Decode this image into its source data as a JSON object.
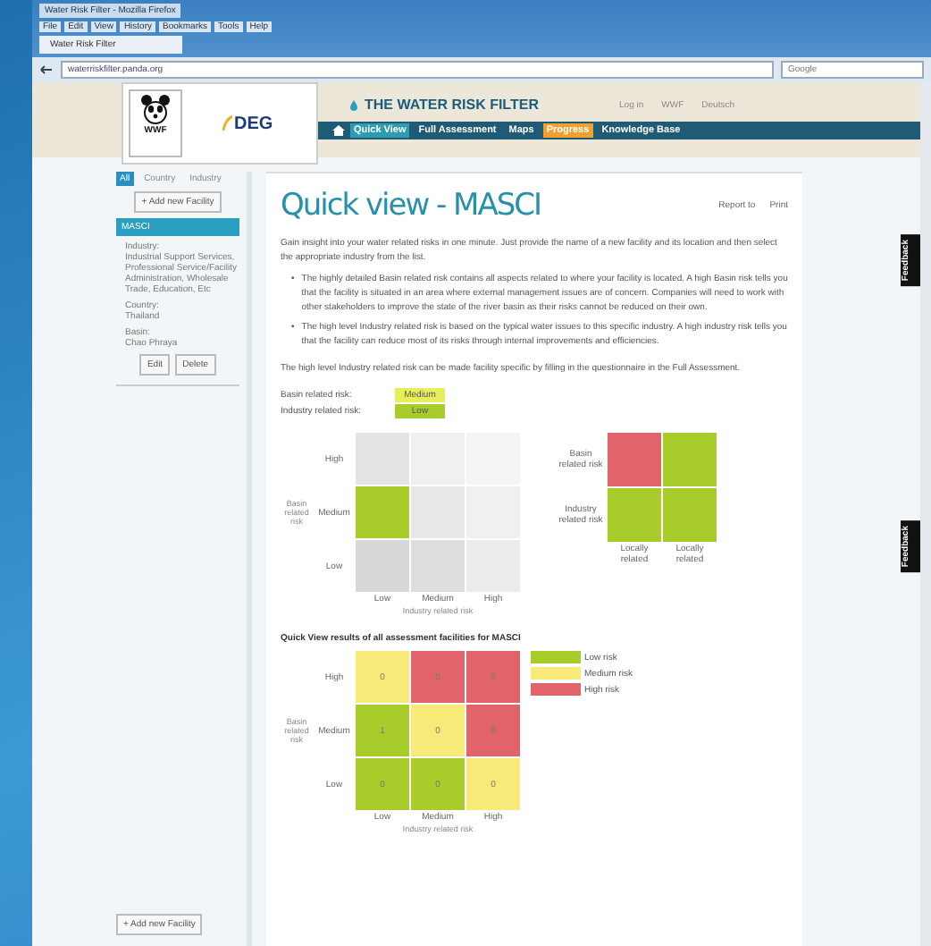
{
  "browser": {
    "title": "Water Risk Filter - Mozilla Firefox",
    "menu": [
      "File",
      "Edit",
      "View",
      "History",
      "Bookmarks",
      "Tools",
      "Help"
    ],
    "tab": "Water Risk Filter",
    "address": "waterriskfilter.panda.org",
    "search_placeholder": "Google"
  },
  "header": {
    "logo_text": "WWF",
    "partner": "DEG",
    "site_title": "THE WATER RISK FILTER",
    "top_links": [
      "Log in",
      "WWF",
      "Deutsch"
    ]
  },
  "nav": [
    {
      "label": "Quick View",
      "selected": true,
      "highlighted": false
    },
    {
      "label": "Full Assessment",
      "selected": false,
      "highlighted": false
    },
    {
      "label": "Maps",
      "selected": false,
      "highlighted": false
    },
    {
      "label": "Progress",
      "selected": false,
      "highlighted": true
    },
    {
      "label": "Knowledge Base",
      "selected": false,
      "highlighted": false
    }
  ],
  "sidebar": {
    "filters": [
      {
        "label": "All",
        "selected": true
      },
      {
        "label": "Country",
        "selected": false
      },
      {
        "label": "Industry",
        "selected": false
      }
    ],
    "add_button": "+ Add new Facility",
    "facility": {
      "name": "MASCI",
      "selected": true,
      "details": [
        {
          "label": "Industry:",
          "value": "Industrial Support Services, Professional Service/Facility Administration, Wholesale Trade, Education, Etc"
        },
        {
          "label": "Country:",
          "value": "Thailand"
        },
        {
          "label": "Basin:",
          "value": "Chao Phraya"
        }
      ]
    },
    "buttons": [
      "Edit",
      "Delete"
    ],
    "bottom_button": "+ Add new Facility"
  },
  "main": {
    "title": "Quick view - MASCI",
    "actions": [
      "Report to",
      "Print"
    ],
    "intro": "Gain insight into your water related risks in one minute. Just provide the name of a new facility and its location and then select the appropriate industry from the list.",
    "bullets": [
      {
        "marker": "•",
        "text": "The highly detailed Basin related risk contains all aspects related to where your facility is located. A high Basin risk tells you that the facility is situated in an area where external management issues are of concern. Companies will need to work with other stakeholders to improve the state of the river basin as their risks cannot be reduced on their own."
      },
      {
        "marker": "•",
        "text": "The high level Industry related risk is based on the typical water issues to this specific industry. A high industry risk tells you that the facility can reduce most of its risks through internal improvements and efficiencies."
      }
    ],
    "note": "The high level Industry related risk can be made facility specific by filling in the questionnaire in the Full Assessment.",
    "risks": [
      {
        "label": "Basin related risk:",
        "value": "Medium",
        "color": "#e8ee5a"
      },
      {
        "label": "Industry related risk:",
        "value": "Low",
        "color": "#a8cc2a"
      }
    ],
    "matrix": {
      "ylabel": "Basin related risk",
      "xlabel": "Industry related risk",
      "rows": [
        "High",
        "Medium",
        "Low"
      ],
      "columns": [
        "Low",
        "Medium",
        "High"
      ],
      "cells": [
        [
          {
            "color": "#e4e4e4"
          },
          {
            "color": "#f0f0f0"
          },
          {
            "color": "#f4f4f4"
          }
        ],
        [
          {
            "color": "#a8cc2a"
          },
          {
            "color": "#e8e8e8"
          },
          {
            "color": "#f0f0f0"
          }
        ],
        [
          {
            "color": "#d8d8d8"
          },
          {
            "color": "#dedede"
          },
          {
            "color": "#ececec"
          }
        ]
      ]
    },
    "split": {
      "rows": [
        "Basin related risk",
        "Industry related risk"
      ],
      "columns": [
        "Locally related",
        "Locally related"
      ],
      "cells": [
        [
          {
            "color": "#e0646a"
          },
          {
            "color": "#a8cc2a"
          }
        ],
        [
          {
            "color": "#a8cc2a"
          },
          {
            "color": "#a8cc2a"
          }
        ]
      ]
    },
    "results_title": "Quick View results of all assessment facilities for MASCI",
    "results": {
      "ylabel": "Basin related risk",
      "xlabel": "Industry related risk",
      "rows": [
        "High",
        "Medium",
        "Low"
      ],
      "columns": [
        "Low",
        "Medium",
        "High"
      ],
      "cells": [
        [
          {
            "value": "0",
            "color": "#f7ea78"
          },
          {
            "value": "0",
            "color": "#e0646a"
          },
          {
            "value": "0",
            "color": "#e0646a"
          }
        ],
        [
          {
            "value": "1",
            "color": "#a8cc2a"
          },
          {
            "value": "0",
            "color": "#f7ea78"
          },
          {
            "value": "0",
            "color": "#e0646a"
          }
        ],
        [
          {
            "value": "0",
            "color": "#a8cc2a"
          },
          {
            "value": "0",
            "color": "#a8cc2a"
          },
          {
            "value": "0",
            "color": "#f7ea78"
          }
        ]
      ],
      "legend": [
        {
          "label": "Low risk",
          "color": "#a8cc2a"
        },
        {
          "label": "Medium risk",
          "color": "#f7ea78"
        },
        {
          "label": "High risk",
          "color": "#e0646a"
        }
      ]
    }
  },
  "feedback_tabs": [
    "Feedback",
    "Feedback"
  ]
}
